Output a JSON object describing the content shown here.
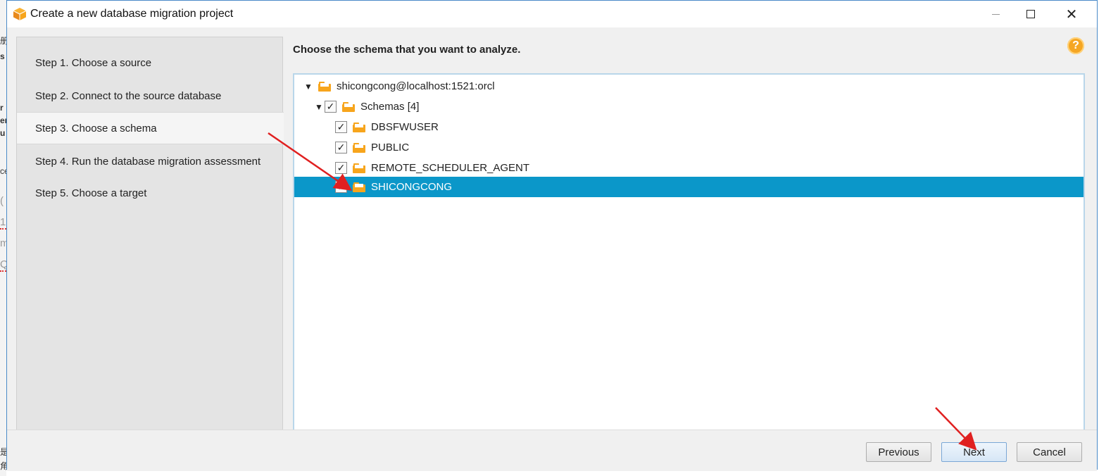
{
  "window": {
    "title": "Create a new database migration project"
  },
  "steps": [
    {
      "label": "Step 1. Choose a source",
      "active": false
    },
    {
      "label": "Step 2. Connect to the source database",
      "active": false
    },
    {
      "label": "Step 3. Choose a schema",
      "active": true
    },
    {
      "label": "Step 4. Run the database migration assessment",
      "active": false
    },
    {
      "label": "Step 5. Choose a target",
      "active": false
    }
  ],
  "main": {
    "heading": "Choose the schema that you want to analyze.",
    "help_icon": "question-icon"
  },
  "tree": {
    "root": "shicongcong@localhost:1521:orcl",
    "schemas_label": "Schemas [4]",
    "schemas": [
      {
        "name": "DBSFWUSER",
        "checked": true,
        "selected": false
      },
      {
        "name": "PUBLIC",
        "checked": true,
        "selected": false
      },
      {
        "name": "REMOTE_SCHEDULER_AGENT",
        "checked": true,
        "selected": false
      },
      {
        "name": "SHICONGCONG",
        "checked": true,
        "selected": true
      }
    ]
  },
  "footer": {
    "previous": "Previous",
    "next": "Next",
    "cancel": "Cancel"
  },
  "colors": {
    "selection": "#0b97c9",
    "folder": "#f7a51c",
    "annotation_arrow": "#e02020"
  },
  "background_app": {
    "fragments": [
      "册",
      "s",
      "r",
      "er",
      "u",
      "ce",
      "(",
      "1",
      "m",
      "Q",
      "是",
      "角"
    ]
  }
}
